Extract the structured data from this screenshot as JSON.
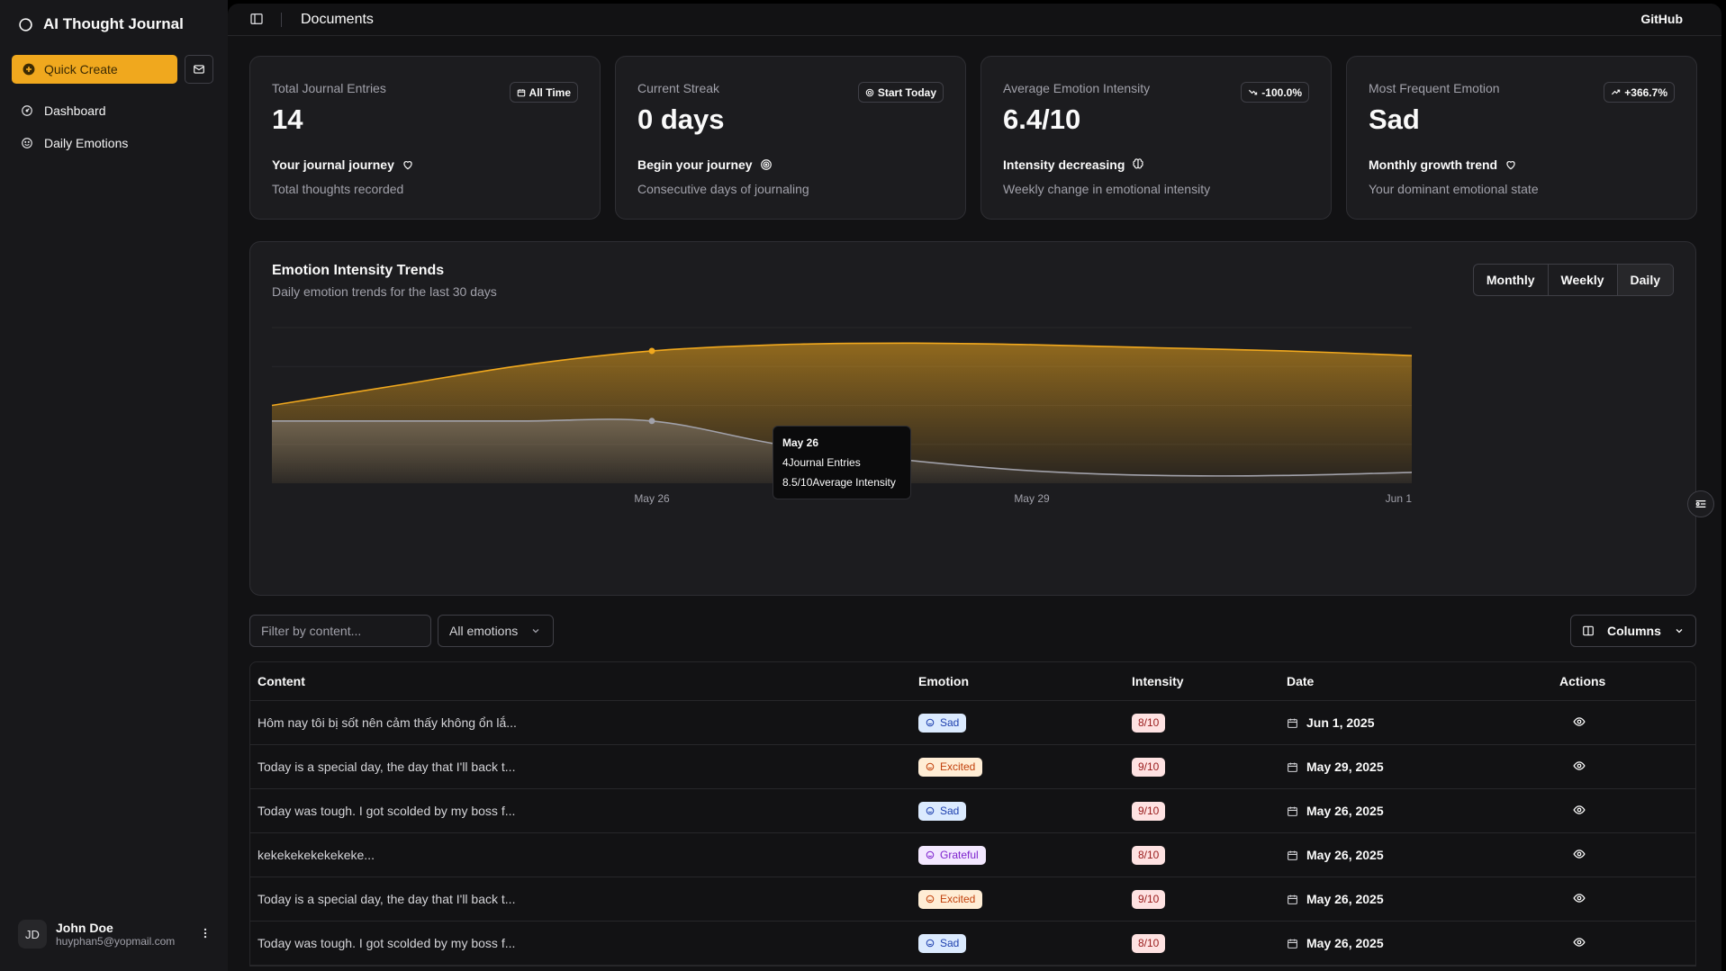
{
  "app": {
    "name": "AI Thought Journal"
  },
  "sidebar": {
    "quick_create_label": "Quick Create",
    "items": [
      {
        "label": "Dashboard",
        "icon": "dashboard-icon"
      },
      {
        "label": "Daily Emotions",
        "icon": "smile-icon"
      }
    ],
    "user": {
      "initials": "JD",
      "name": "John Doe",
      "email": "huyphan5@yopmail.com"
    }
  },
  "topbar": {
    "title": "Documents",
    "github_label": "GitHub"
  },
  "stats": [
    {
      "label": "Total Journal Entries",
      "value": "14",
      "badge": "All Time",
      "badge_icon": "calendar-icon",
      "footer": "Your journal journey",
      "footer_icon": "heart-icon",
      "sub": "Total thoughts recorded"
    },
    {
      "label": "Current Streak",
      "value": "0 days",
      "badge": "Start Today",
      "badge_icon": "target-icon",
      "footer": "Begin your journey",
      "footer_icon": "target-icon",
      "sub": "Consecutive days of journaling"
    },
    {
      "label": "Average Emotion Intensity",
      "value": "6.4/10",
      "badge": "-100.0%",
      "badge_icon": "trend-down-icon",
      "footer": "Intensity decreasing",
      "footer_icon": "brain-icon",
      "sub": "Weekly change in emotional intensity"
    },
    {
      "label": "Most Frequent Emotion",
      "value": "Sad",
      "badge": "+366.7%",
      "badge_icon": "trend-up-icon",
      "footer": "Monthly growth trend",
      "footer_icon": "heart-icon",
      "sub": "Your dominant emotional state"
    }
  ],
  "chart": {
    "title": "Emotion Intensity Trends",
    "subtitle": "Daily emotion trends for the last 30 days",
    "ranges": [
      "Monthly",
      "Weekly",
      "Daily"
    ],
    "active_range": "Daily",
    "tooltip": {
      "date": "May 26",
      "entries_line": "4Journal Entries",
      "intensity_line": "8.5/10Average Intensity"
    }
  },
  "chart_data": {
    "type": "area",
    "x": [
      "May 23",
      "May 24",
      "May 25",
      "May 26",
      "May 27",
      "May 28",
      "May 29",
      "May 30",
      "May 31",
      "Jun 1"
    ],
    "x_tick_labels": [
      "May 26",
      "May 29",
      "Jun 1"
    ],
    "grid": true,
    "series": [
      {
        "values": [
          5.0,
          6.3,
          7.6,
          8.5,
          8.9,
          9.0,
          8.9,
          8.7,
          8.5,
          8.2
        ],
        "color": "#f0a81e"
      },
      {
        "values": [
          4,
          4,
          4,
          4,
          2.5,
          1.5,
          0.8,
          0.5,
          0.5,
          0.7
        ],
        "color": "#a1a1aa"
      }
    ],
    "ylim": [
      0,
      10
    ],
    "legend": "none"
  },
  "filters": {
    "content_placeholder": "Filter by content...",
    "emotion_select": "All emotions",
    "columns_label": "Columns"
  },
  "table": {
    "headers": [
      "Content",
      "Emotion",
      "Intensity",
      "Date",
      "Actions"
    ],
    "rows": [
      {
        "content": "Hôm nay tôi bị sốt nên cảm thấy không ổn lắ...",
        "emotion": "Sad",
        "intensity": "8/10",
        "date": "Jun 1, 2025"
      },
      {
        "content": "Today is a special day, the day that I'll back t...",
        "emotion": "Excited",
        "intensity": "9/10",
        "date": "May 29, 2025"
      },
      {
        "content": "Today was tough. I got scolded by my boss f...",
        "emotion": "Sad",
        "intensity": "9/10",
        "date": "May 26, 2025"
      },
      {
        "content": "kekekekekekekeke...",
        "emotion": "Grateful",
        "intensity": "8/10",
        "date": "May 26, 2025"
      },
      {
        "content": "Today is a special day, the day that I'll back t...",
        "emotion": "Excited",
        "intensity": "9/10",
        "date": "May 26, 2025"
      },
      {
        "content": "Today was tough. I got scolded by my boss f...",
        "emotion": "Sad",
        "intensity": "8/10",
        "date": "May 26, 2025"
      }
    ]
  },
  "colors": {
    "accent": "#f0a81e",
    "background": "#121214",
    "card": "#1c1c1f"
  }
}
